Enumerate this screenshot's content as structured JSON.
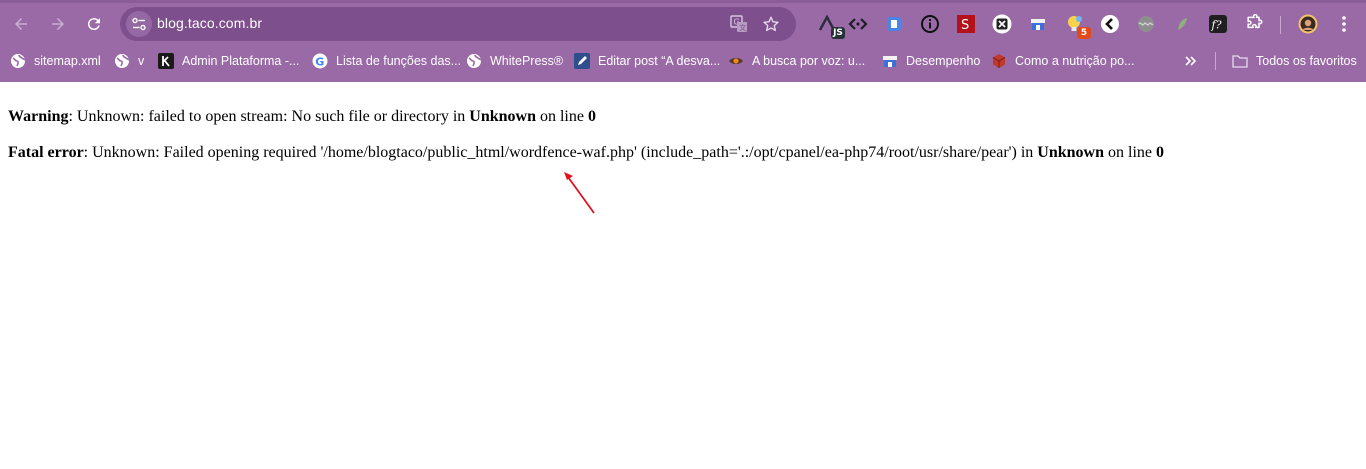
{
  "browser": {
    "url": "blog.taco.com.br",
    "colors": {
      "frame": "#9a6aa6",
      "omnibox": "#7d4f8c",
      "text": "#ffffff"
    }
  },
  "toolbar": {
    "icons": [
      "back-icon",
      "forward-icon",
      "reload-icon",
      "site-info-icon",
      "translate-icon",
      "bookmark-star-icon"
    ],
    "extensions": [
      {
        "name": "js-extension-icon",
        "badge": "JS"
      },
      {
        "name": "code-extension-icon"
      },
      {
        "name": "blue-extension-icon"
      },
      {
        "name": "info-extension-icon"
      },
      {
        "name": "red-s-extension-icon",
        "label": "S"
      },
      {
        "name": "x-extension-icon",
        "label": "X"
      },
      {
        "name": "store-extension-icon"
      },
      {
        "name": "lightbulb-extension-icon",
        "badge": "5"
      },
      {
        "name": "back-circle-extension-icon"
      },
      {
        "name": "wave-extension-icon"
      },
      {
        "name": "leaf-extension-icon"
      },
      {
        "name": "fx-extension-icon",
        "label": "f?"
      },
      {
        "name": "puzzle-extensions-icon"
      },
      {
        "name": "profile-avatar-icon"
      },
      {
        "name": "menu-kebab-icon"
      }
    ]
  },
  "bookmarks": {
    "items": [
      {
        "label": "sitemap.xml",
        "icon": "globe-icon"
      },
      {
        "label": "v",
        "icon": "globe-icon"
      },
      {
        "label": "Admin Plataforma -...",
        "icon": "k-logo-icon"
      },
      {
        "label": "Lista de funções das...",
        "icon": "google-icon"
      },
      {
        "label": "WhitePress®",
        "icon": "globe-icon"
      },
      {
        "label": "Editar post “A desva...",
        "icon": "wordpress-edit-icon"
      },
      {
        "label": "A busca por voz: u...",
        "icon": "eye-logo-icon"
      },
      {
        "label": "Desempenho",
        "icon": "store-icon"
      },
      {
        "label": "Como a nutrição po...",
        "icon": "cube-icon"
      }
    ],
    "overflow_icon": "chevron-double-right-icon",
    "all_bookmarks_label": "Todos os favoritos"
  },
  "page": {
    "warning": {
      "label": "Warning",
      "message": ": Unknown: failed to open stream: No such file or directory in ",
      "location": "Unknown",
      "line_text": " on line ",
      "line_no": "0"
    },
    "fatal": {
      "label": "Fatal error",
      "message": ": Unknown: Failed opening required '/home/blogtaco/public_html/wordfence-waf.php' (include_path='.:/opt/cpanel/ea-php74/root/usr/share/pear') in ",
      "location": "Unknown",
      "line_text": " on line ",
      "line_no": "0"
    },
    "annotation": {
      "icon": "red-arrow-annotation-icon",
      "color": "#e0121b"
    }
  }
}
